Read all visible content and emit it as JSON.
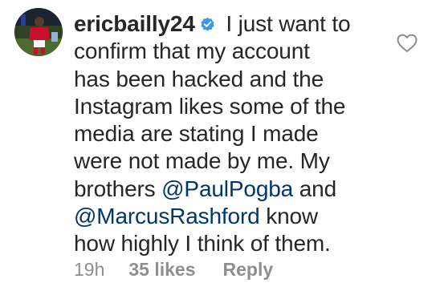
{
  "comment": {
    "username": "ericbailly24",
    "verified": true,
    "text_lines": [
      " I just want to",
      "confirm that my account",
      "has been hacked and the",
      "Instagram likes some of the",
      "media are stating I made",
      "were not made by me. My",
      "brothers "
    ],
    "mention_1": "@PaulPogba",
    "after_mention_1": " and",
    "mention_2": "@MarcusRashford",
    "after_mention_2": " know",
    "last_line": "how highly I think of them.",
    "time": "19h",
    "likes": "35 likes",
    "reply_label": "Reply"
  },
  "icons": {
    "like": "heart-outline-icon",
    "verified": "verified-badge-icon",
    "avatar": "profile-avatar"
  },
  "colors": {
    "text": "#262626",
    "mention": "#00376b",
    "meta": "#8e8e8e",
    "verified_badge": "#3897f0"
  }
}
